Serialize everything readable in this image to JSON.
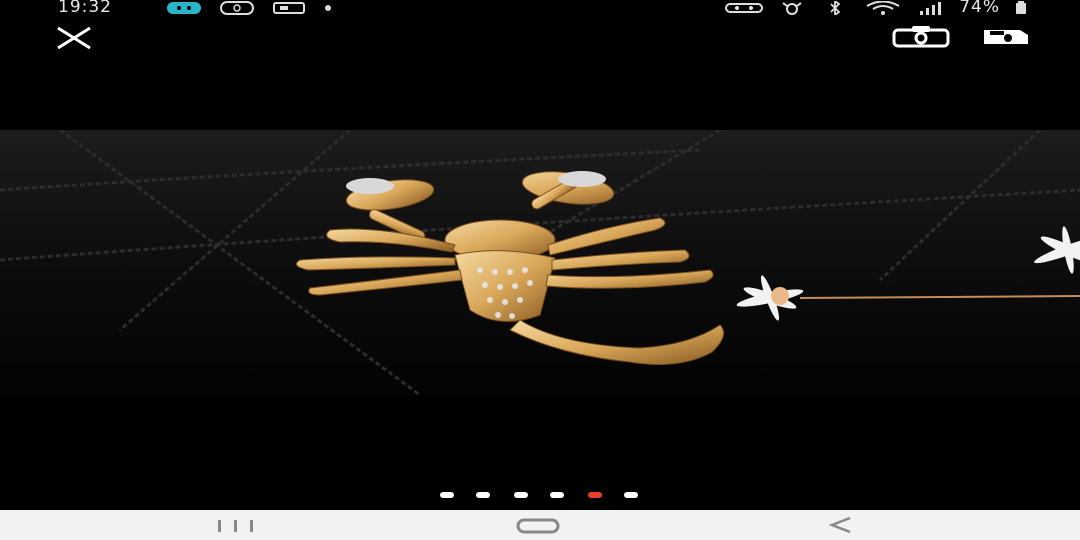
{
  "status_bar": {
    "time": "19:32",
    "battery_percent": "74%",
    "left_icons": [
      "chat-app-icon",
      "phone-app-icon",
      "gallery-app-icon",
      "notification-dot-icon"
    ],
    "right_icons": [
      "vr-icon",
      "alarm-icon",
      "bluetooth-icon",
      "wifi-icon",
      "signal-icon",
      "battery-icon"
    ]
  },
  "toolbar": {
    "close_icon": "close-icon",
    "camera_icon": "camera-icon",
    "save_icon": "save-icon"
  },
  "photo": {
    "subject": "scorpion-brooch",
    "background_color": "#0b0b0b",
    "accent_gold": "#d9a85a"
  },
  "pager": {
    "total": 6,
    "active_index": 4,
    "active_color": "#e8402a",
    "inactive_color": "#ffffff"
  },
  "nav_bar": {
    "recents_icon": "recents-icon",
    "home_icon": "home-icon",
    "back_icon": "back-icon"
  }
}
